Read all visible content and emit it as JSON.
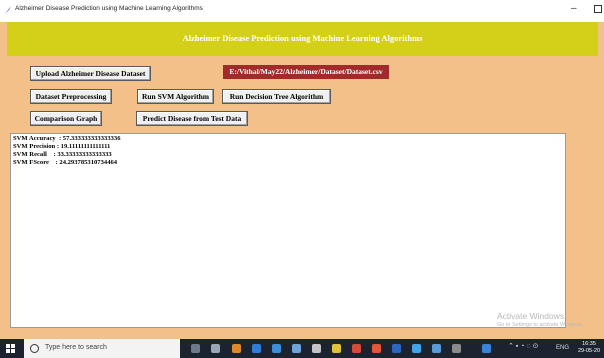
{
  "window": {
    "title": "Alzheimer Disease Prediction using Machine Learning Algorithms",
    "minimize_glyph": "–"
  },
  "banner": {
    "heading": "Alzheimer Disease Prediction using Machine Learning Algorithms",
    "color": "#d4d01a"
  },
  "buttons": {
    "upload": "Upload Alzheimer Disease Dataset",
    "preprocess": "Dataset Preprocessing",
    "svm": "Run SVM Algorithm",
    "tree": "Run Decision Tree Algorithm",
    "graph": "Comparison Graph",
    "predict": "Predict Disease from Test Data"
  },
  "dataset_path": "E:/Vithal/May22/Alzheimer/Dataset/Dataset.csv",
  "output_lines": [
    "SVM Accuracy  : 57.333333333333336",
    "SVM Precision : 19.11111111111111",
    "SVM Recall    : 33.33333333333333",
    "SVM FScore    : 24.293785310734464"
  ],
  "watermark": {
    "line1": "Activate Windows",
    "line2": "Go to Settings to activate Windows."
  },
  "taskbar": {
    "search_placeholder": "Type here to search",
    "tray_text": "ENG",
    "time": "16:35",
    "date": "29-05-20"
  },
  "colors": {
    "background": "#f4c089",
    "path_label": "#a12a2a",
    "taskbar": "#1c2330"
  }
}
